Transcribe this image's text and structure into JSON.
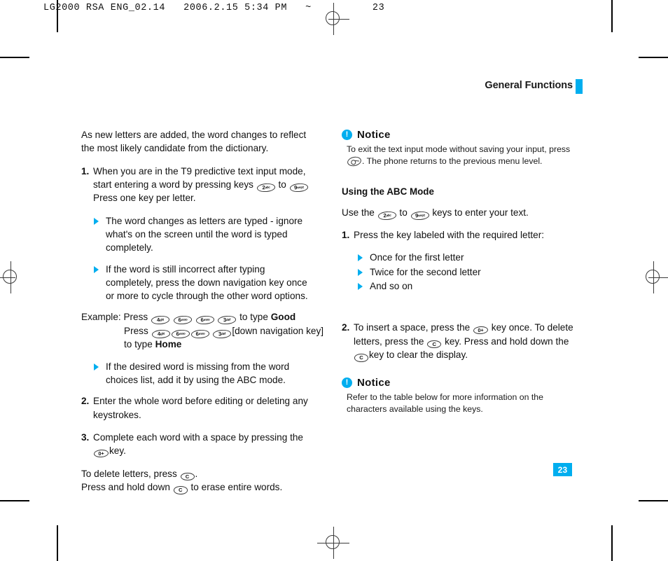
{
  "prepress": {
    "proof_line": "LG2000 RSA ENG_02.14   2006.2.15 5:34 PM   ~          23"
  },
  "header": {
    "running_title": "General Functions",
    "accent_color": "#00aeef"
  },
  "folio": {
    "page_number": "23"
  },
  "left_column": {
    "intro": "As new letters are added, the word changes to reflect the most likely candidate from the dictionary.",
    "step1": {
      "num": "1.",
      "text_a": "When you are in the T9 predictive text input mode, start entering a word by pressing keys",
      "text_b": "to",
      "text_c": "Press one key per letter.",
      "key_from": {
        "digit": "2",
        "letters": "abc"
      },
      "key_to": {
        "digit": "9",
        "letters": "wxyz"
      }
    },
    "bullets_after_step1": [
      "The word changes as letters are typed - ignore what's on the screen until the word is typed completely.",
      "If the word is still incorrect after typing completely, press the down navigation key once or more to cycle through the other word options."
    ],
    "example": {
      "label": "Example: Press",
      "line1_keys": [
        {
          "digit": "4",
          "letters": "ghi"
        },
        {
          "digit": "6",
          "letters": "mno"
        },
        {
          "digit": "6",
          "letters": "mno"
        },
        {
          "digit": "3",
          "letters": "def"
        }
      ],
      "line1_tail": "to type",
      "line1_word": "Good",
      "line2_label": "Press",
      "line2_keys": [
        {
          "digit": "4",
          "letters": "ghi"
        },
        {
          "digit": "6",
          "letters": "mno"
        },
        {
          "digit": "6",
          "letters": "mno"
        },
        {
          "digit": "3",
          "letters": "def"
        }
      ],
      "line2_tail": "[down navigation key]",
      "line3_label": "to type",
      "line3_word": "Home"
    },
    "bullet_abc": "If the desired word is missing from the word choices list, add it by using the ABC mode.",
    "step2": {
      "num": "2.",
      "text": "Enter the whole word before editing or deleting any keystrokes."
    },
    "step3": {
      "num": "3.",
      "text_a": "Complete each word with a space by pressing the",
      "text_b": "key.",
      "key": "0+"
    },
    "closing": {
      "line1_a": "To delete letters, press",
      "line1_b": ".",
      "line2_a": "Press and hold down",
      "line2_b": "to erase entire words.",
      "key": "C"
    }
  },
  "right_column": {
    "notice1": {
      "icon": "exclamation-icon",
      "title": "Notice",
      "text_a": "To exit the text input mode without saving your input, press",
      "text_b": ". The phone returns to the previous menu level.",
      "key": "end-call-key"
    },
    "subhead": "Using the ABC Mode",
    "intro": {
      "text_a": "Use the",
      "text_b": "to",
      "text_c": "keys to enter your text.",
      "key_from": {
        "digit": "2",
        "letters": "abc"
      },
      "key_to": {
        "digit": "9",
        "letters": "wxyz"
      }
    },
    "step1": {
      "num": "1.",
      "text": "Press the key labeled with the required letter:"
    },
    "step1_bullets": [
      "Once for the first letter",
      "Twice for the second letter",
      "And so on"
    ],
    "step2": {
      "num": "2.",
      "text_a": "To insert a space, press the",
      "text_b": "key once. To delete letters, press the",
      "text_c": "key. Press and hold down the",
      "text_d": "key to clear the display.",
      "key_space": "0+",
      "key_clear": "C"
    },
    "notice2": {
      "icon": "exclamation-icon",
      "title": "Notice",
      "text": "Refer to the table below for more information on the characters available using the keys."
    }
  }
}
